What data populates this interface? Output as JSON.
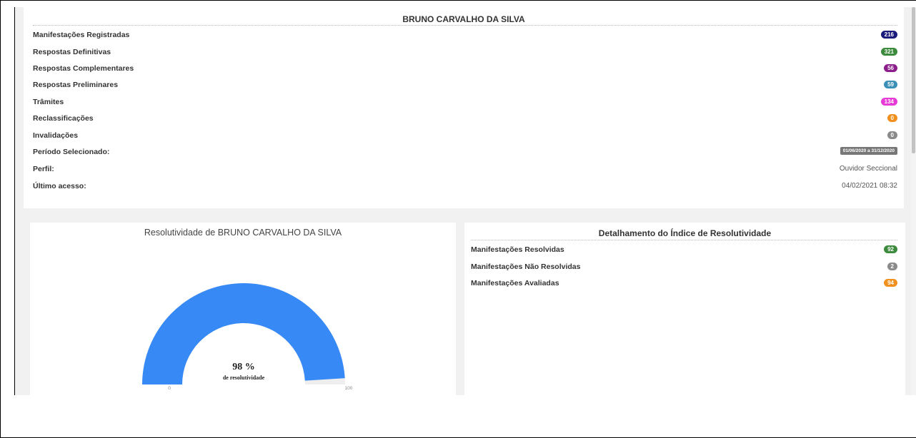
{
  "summary": {
    "title": "BRUNO CARVALHO DA SILVA",
    "rows": [
      {
        "label": "Manifestações Registradas",
        "value": "216",
        "color": "#1a1a7a"
      },
      {
        "label": "Respostas Definitivas",
        "value": "321",
        "color": "#3c8a3c"
      },
      {
        "label": "Respostas Complementares",
        "value": "56",
        "color": "#8b1e8b"
      },
      {
        "label": "Respostas Preliminares",
        "value": "59",
        "color": "#3a8fb7"
      },
      {
        "label": "Trâmites",
        "value": "134",
        "color": "#e83ad6"
      },
      {
        "label": "Reclassificações",
        "value": "0",
        "color": "#f0901e"
      },
      {
        "label": "Invalidações",
        "value": "0",
        "color": "#8a8a8a"
      }
    ],
    "period_label": "Período Selecionado:",
    "period_value": "01/06/2020 a 31/12/2020",
    "profile_label": "Perfil:",
    "profile_value": "Ouvidor Seccional",
    "last_access_label": "Último acesso:",
    "last_access_value": "04/02/2021 08:32"
  },
  "gauge": {
    "title": "Resolutividade de BRUNO CARVALHO DA SILVA",
    "value_text": "98 %",
    "caption": "de resolutividade",
    "min_label": "0",
    "max_label": "100",
    "chart_data": {
      "type": "gauge",
      "value": 98,
      "min": 0,
      "max": 100,
      "color": "#3789f6",
      "track_color": "#eeeeee"
    }
  },
  "detail": {
    "title": "Detalhamento do Índice de Resolutividade",
    "rows": [
      {
        "label": "Manifestações Resolvidas",
        "value": "92",
        "color": "#3c8a3c"
      },
      {
        "label": "Manifestações Não Resolvidas",
        "value": "2",
        "color": "#8a8a8a"
      },
      {
        "label": "Manifestações Avaliadas",
        "value": "94",
        "color": "#f0901e"
      }
    ]
  }
}
